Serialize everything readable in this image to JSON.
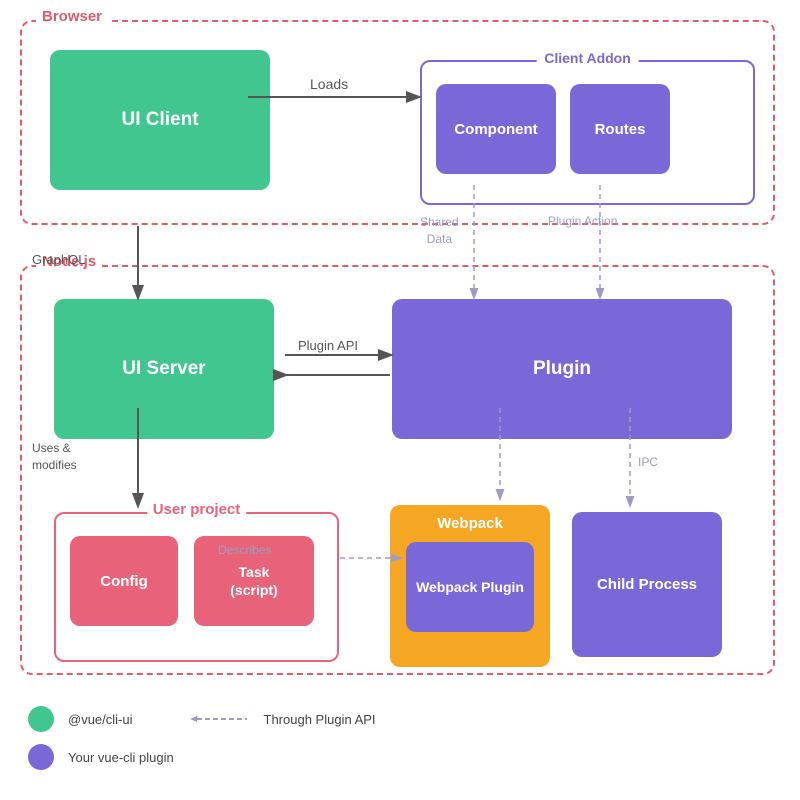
{
  "sections": {
    "browser": {
      "label": "Browser"
    },
    "nodejs": {
      "label": "Node.js"
    }
  },
  "boxes": {
    "ui_client": "UI Client",
    "client_addon": "Client Addon",
    "component": "Component",
    "routes": "Routes",
    "ui_server": "UI Server",
    "plugin": "Plugin",
    "user_project": "User project",
    "config": "Config",
    "task_script": "Task\n(script)",
    "webpack": "Webpack",
    "webpack_plugin": "Webpack Plugin",
    "child_process": "Child Process"
  },
  "arrows": {
    "loads": "Loads",
    "graphql": "GraphQL",
    "shared_data": "Shared\nData",
    "plugin_action": "Plugin Action",
    "plugin_api": "Plugin API",
    "uses_modifies": "Uses &\nmodifies",
    "describes": "Describes",
    "ipc": "IPC"
  },
  "legend": {
    "green_label": "@vue/cli-ui",
    "purple_label": "Your vue-cli plugin",
    "dashed_label": "Through Plugin API"
  }
}
